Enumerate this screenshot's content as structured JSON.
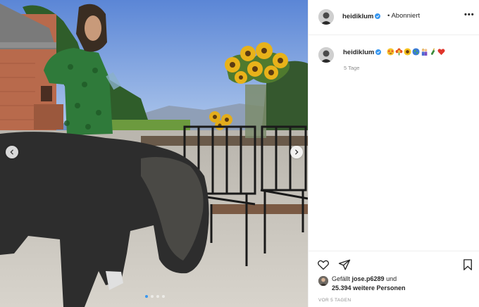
{
  "post": {
    "username": "heidiklum",
    "follow_separator": "•",
    "follow_state": "Abonniert",
    "more_label": "•••",
    "caption_emojis": [
      "star-eyes-emoji",
      "flower-emoji",
      "sunflower-emoji",
      "globe-emoji",
      "couple-emoji",
      "champagne-emoji",
      "red-heart-emoji"
    ],
    "comment_age": "5 Tage",
    "likes_prefix": "Gefällt",
    "likes_user": "jose.p6289",
    "likes_and": "und",
    "likes_count": "25.394 weitere Personen",
    "post_date": "VOR 5 TAGEN",
    "carousel_dot_count": 4,
    "carousel_active_index": 0,
    "verified_color": "#3897f0",
    "heart_color": "#ed4956"
  }
}
